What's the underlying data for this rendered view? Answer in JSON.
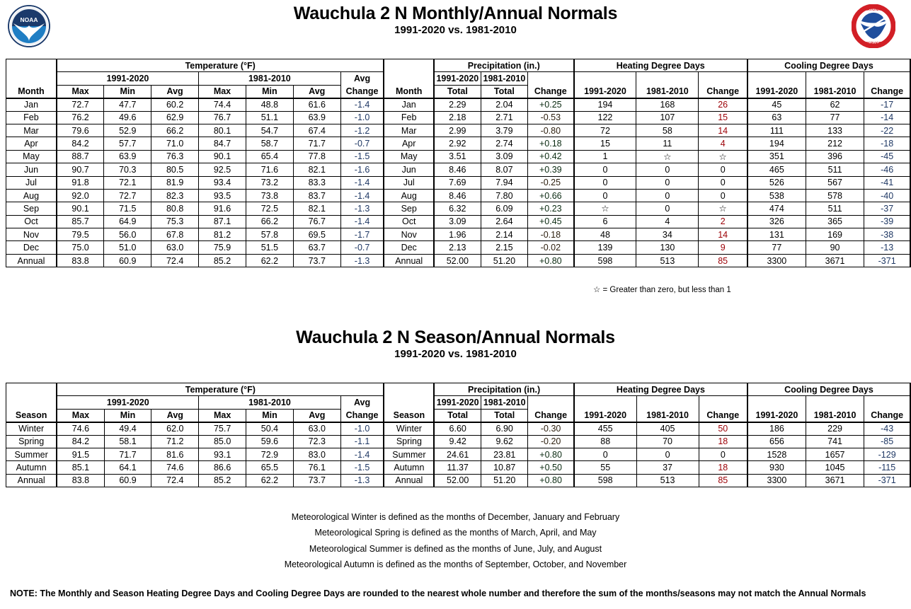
{
  "monthly": {
    "title": "Wauchula 2 N Monthly/Annual Normals",
    "subtitle": "1991-2020 vs. 1981-2010",
    "groups": {
      "temperature": "Temperature (°F)",
      "precipitation": "Precipitation (in.)",
      "heating": "Heating Degree Days",
      "cooling": "Cooling Degree Days"
    },
    "periods": {
      "new": "1991-2020",
      "old": "1981-2010"
    },
    "headers": {
      "month": "Month",
      "max": "Max",
      "min": "Min",
      "avg": "Avg",
      "avg_change_l1": "Avg",
      "avg_change_l2": "Change",
      "total": "Total",
      "change": "Change"
    },
    "rows": [
      {
        "label": "Jan",
        "t_new": [
          "72.7",
          "47.7",
          "60.2"
        ],
        "t_old": [
          "74.4",
          "48.8",
          "61.6"
        ],
        "t_chg": "-1.4",
        "p_new": "2.29",
        "p_old": "2.04",
        "p_chg": "+0.25",
        "p_chg_color": "green",
        "hdd_new": "194",
        "hdd_old": "168",
        "hdd_chg": "26",
        "hdd_chg_color": "pink",
        "cdd_new": "45",
        "cdd_old": "62",
        "cdd_chg": "-17"
      },
      {
        "label": "Feb",
        "t_new": [
          "76.2",
          "49.6",
          "62.9"
        ],
        "t_old": [
          "76.7",
          "51.1",
          "63.9"
        ],
        "t_chg": "-1.0",
        "p_new": "2.18",
        "p_old": "2.71",
        "p_chg": "-0.53",
        "p_chg_color": "tan",
        "hdd_new": "122",
        "hdd_old": "107",
        "hdd_chg": "15",
        "hdd_chg_color": "pink",
        "cdd_new": "63",
        "cdd_old": "77",
        "cdd_chg": "-14"
      },
      {
        "label": "Mar",
        "t_new": [
          "79.6",
          "52.9",
          "66.2"
        ],
        "t_old": [
          "80.1",
          "54.7",
          "67.4"
        ],
        "t_chg": "-1.2",
        "p_new": "2.99",
        "p_old": "3.79",
        "p_chg": "-0.80",
        "p_chg_color": "tan",
        "hdd_new": "72",
        "hdd_old": "58",
        "hdd_chg": "14",
        "hdd_chg_color": "pink",
        "cdd_new": "111",
        "cdd_old": "133",
        "cdd_chg": "-22"
      },
      {
        "label": "Apr",
        "t_new": [
          "84.2",
          "57.7",
          "71.0"
        ],
        "t_old": [
          "84.7",
          "58.7",
          "71.7"
        ],
        "t_chg": "-0.7",
        "p_new": "2.92",
        "p_old": "2.74",
        "p_chg": "+0.18",
        "p_chg_color": "green",
        "hdd_new": "15",
        "hdd_old": "11",
        "hdd_chg": "4",
        "hdd_chg_color": "pink",
        "cdd_new": "194",
        "cdd_old": "212",
        "cdd_chg": "-18"
      },
      {
        "label": "May",
        "t_new": [
          "88.7",
          "63.9",
          "76.3"
        ],
        "t_old": [
          "90.1",
          "65.4",
          "77.8"
        ],
        "t_chg": "-1.5",
        "p_new": "3.51",
        "p_old": "3.09",
        "p_chg": "+0.42",
        "p_chg_color": "green",
        "hdd_new": "1",
        "hdd_old": "☆",
        "hdd_chg": "☆",
        "hdd_chg_color": "none",
        "cdd_new": "351",
        "cdd_old": "396",
        "cdd_chg": "-45"
      },
      {
        "label": "Jun",
        "t_new": [
          "90.7",
          "70.3",
          "80.5"
        ],
        "t_old": [
          "92.5",
          "71.6",
          "82.1"
        ],
        "t_chg": "-1.6",
        "p_new": "8.46",
        "p_old": "8.07",
        "p_chg": "+0.39",
        "p_chg_color": "green",
        "hdd_new": "0",
        "hdd_old": "0",
        "hdd_chg": "0",
        "hdd_chg_color": "none",
        "cdd_new": "465",
        "cdd_old": "511",
        "cdd_chg": "-46"
      },
      {
        "label": "Jul",
        "t_new": [
          "91.8",
          "72.1",
          "81.9"
        ],
        "t_old": [
          "93.4",
          "73.2",
          "83.3"
        ],
        "t_chg": "-1.4",
        "p_new": "7.69",
        "p_old": "7.94",
        "p_chg": "-0.25",
        "p_chg_color": "tan",
        "hdd_new": "0",
        "hdd_old": "0",
        "hdd_chg": "0",
        "hdd_chg_color": "none",
        "cdd_new": "526",
        "cdd_old": "567",
        "cdd_chg": "-41"
      },
      {
        "label": "Aug",
        "t_new": [
          "92.0",
          "72.7",
          "82.3"
        ],
        "t_old": [
          "93.5",
          "73.8",
          "83.7"
        ],
        "t_chg": "-1.4",
        "p_new": "8.46",
        "p_old": "7.80",
        "p_chg": "+0.66",
        "p_chg_color": "green",
        "hdd_new": "0",
        "hdd_old": "0",
        "hdd_chg": "0",
        "hdd_chg_color": "none",
        "cdd_new": "538",
        "cdd_old": "578",
        "cdd_chg": "-40"
      },
      {
        "label": "Sep",
        "t_new": [
          "90.1",
          "71.5",
          "80.8"
        ],
        "t_old": [
          "91.6",
          "72.5",
          "82.1"
        ],
        "t_chg": "-1.3",
        "p_new": "6.32",
        "p_old": "6.09",
        "p_chg": "+0.23",
        "p_chg_color": "green",
        "hdd_new": "☆",
        "hdd_old": "0",
        "hdd_chg": "☆",
        "hdd_chg_color": "none",
        "cdd_new": "474",
        "cdd_old": "511",
        "cdd_chg": "-37"
      },
      {
        "label": "Oct",
        "t_new": [
          "85.7",
          "64.9",
          "75.3"
        ],
        "t_old": [
          "87.1",
          "66.2",
          "76.7"
        ],
        "t_chg": "-1.4",
        "p_new": "3.09",
        "p_old": "2.64",
        "p_chg": "+0.45",
        "p_chg_color": "green",
        "hdd_new": "6",
        "hdd_old": "4",
        "hdd_chg": "2",
        "hdd_chg_color": "pink",
        "cdd_new": "326",
        "cdd_old": "365",
        "cdd_chg": "-39"
      },
      {
        "label": "Nov",
        "t_new": [
          "79.5",
          "56.0",
          "67.8"
        ],
        "t_old": [
          "81.2",
          "57.8",
          "69.5"
        ],
        "t_chg": "-1.7",
        "p_new": "1.96",
        "p_old": "2.14",
        "p_chg": "-0.18",
        "p_chg_color": "tan",
        "hdd_new": "48",
        "hdd_old": "34",
        "hdd_chg": "14",
        "hdd_chg_color": "pink",
        "cdd_new": "131",
        "cdd_old": "169",
        "cdd_chg": "-38"
      },
      {
        "label": "Dec",
        "t_new": [
          "75.0",
          "51.0",
          "63.0"
        ],
        "t_old": [
          "75.9",
          "51.5",
          "63.7"
        ],
        "t_chg": "-0.7",
        "p_new": "2.13",
        "p_old": "2.15",
        "p_chg": "-0.02",
        "p_chg_color": "tan",
        "hdd_new": "139",
        "hdd_old": "130",
        "hdd_chg": "9",
        "hdd_chg_color": "pink",
        "cdd_new": "77",
        "cdd_old": "90",
        "cdd_chg": "-13"
      },
      {
        "label": "Annual",
        "annual": true,
        "t_new": [
          "83.8",
          "60.9",
          "72.4"
        ],
        "t_old": [
          "85.2",
          "62.2",
          "73.7"
        ],
        "t_chg": "-1.3",
        "p_new": "52.00",
        "p_old": "51.20",
        "p_chg": "+0.80",
        "p_chg_color": "green",
        "hdd_new": "598",
        "hdd_old": "513",
        "hdd_chg": "85",
        "hdd_chg_color": "pink",
        "cdd_new": "3300",
        "cdd_old": "3671",
        "cdd_chg": "-371"
      }
    ]
  },
  "season": {
    "title": "Wauchula 2 N Season/Annual Normals",
    "subtitle": "1991-2020 vs. 1981-2010",
    "headers": {
      "season": "Season"
    },
    "rows": [
      {
        "label": "Winter",
        "t_new": [
          "74.6",
          "49.4",
          "62.0"
        ],
        "t_old": [
          "75.7",
          "50.4",
          "63.0"
        ],
        "t_chg": "-1.0",
        "p_new": "6.60",
        "p_old": "6.90",
        "p_chg": "-0.30",
        "p_chg_color": "tan",
        "hdd_new": "455",
        "hdd_old": "405",
        "hdd_chg": "50",
        "hdd_chg_color": "pink",
        "cdd_new": "186",
        "cdd_old": "229",
        "cdd_chg": "-43"
      },
      {
        "label": "Spring",
        "t_new": [
          "84.2",
          "58.1",
          "71.2"
        ],
        "t_old": [
          "85.0",
          "59.6",
          "72.3"
        ],
        "t_chg": "-1.1",
        "p_new": "9.42",
        "p_old": "9.62",
        "p_chg": "-0.20",
        "p_chg_color": "tan",
        "hdd_new": "88",
        "hdd_old": "70",
        "hdd_chg": "18",
        "hdd_chg_color": "pink",
        "cdd_new": "656",
        "cdd_old": "741",
        "cdd_chg": "-85"
      },
      {
        "label": "Summer",
        "t_new": [
          "91.5",
          "71.7",
          "81.6"
        ],
        "t_old": [
          "93.1",
          "72.9",
          "83.0"
        ],
        "t_chg": "-1.4",
        "p_new": "24.61",
        "p_old": "23.81",
        "p_chg": "+0.80",
        "p_chg_color": "green",
        "hdd_new": "0",
        "hdd_old": "0",
        "hdd_chg": "0",
        "hdd_chg_color": "none",
        "cdd_new": "1528",
        "cdd_old": "1657",
        "cdd_chg": "-129"
      },
      {
        "label": "Autumn",
        "t_new": [
          "85.1",
          "64.1",
          "74.6"
        ],
        "t_old": [
          "86.6",
          "65.5",
          "76.1"
        ],
        "t_chg": "-1.5",
        "p_new": "11.37",
        "p_old": "10.87",
        "p_chg": "+0.50",
        "p_chg_color": "green",
        "hdd_new": "55",
        "hdd_old": "37",
        "hdd_chg": "18",
        "hdd_chg_color": "pink",
        "cdd_new": "930",
        "cdd_old": "1045",
        "cdd_chg": "-115"
      },
      {
        "label": "Annual",
        "annual": true,
        "t_new": [
          "83.8",
          "60.9",
          "72.4"
        ],
        "t_old": [
          "85.2",
          "62.2",
          "73.7"
        ],
        "t_chg": "-1.3",
        "p_new": "52.00",
        "p_old": "51.20",
        "p_chg": "+0.80",
        "p_chg_color": "green",
        "hdd_new": "598",
        "hdd_old": "513",
        "hdd_chg": "85",
        "hdd_chg_color": "pink",
        "cdd_new": "3300",
        "cdd_old": "3671",
        "cdd_chg": "-371"
      }
    ]
  },
  "footnotes": {
    "star": "☆ = Greater than zero, but less than 1",
    "definitions": [
      "Meteorological Winter is defined as the months of December, January and February",
      "Meteorological Spring is defined as the months of March, April, and May",
      "Meteorological Summer is defined as the months of June, July, and August",
      "Meteorological Autumn is defined as the months of September, October, and November"
    ],
    "note": "NOTE:  The Monthly and Season Heating Degree Days and Cooling Degree Days are rounded to the nearest whole number and therefore the sum of the months/seasons may not match the Annual Normals"
  },
  "logos": {
    "noaa": "noaa-logo",
    "nws": "nws-logo"
  },
  "colors": {
    "blue": "#BDD7EE",
    "green": "#C6EFCE",
    "tan": "#D7C4A8",
    "pink": "#FFC7CE",
    "blue_text": "#1F3864",
    "pink_text": "#9C0006"
  }
}
